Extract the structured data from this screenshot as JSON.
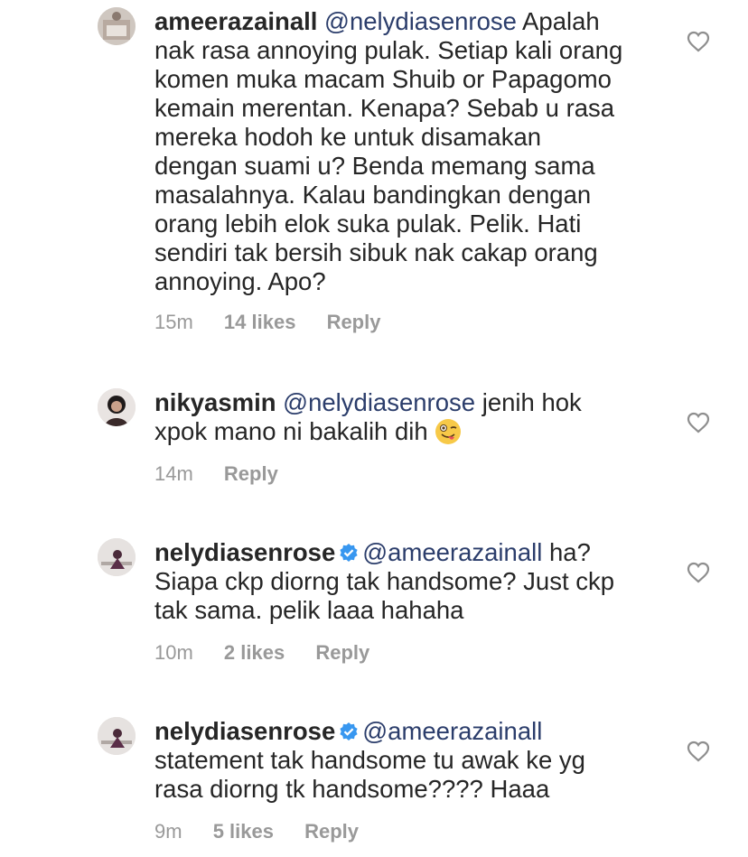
{
  "comments": [
    {
      "username": "ameerazainall",
      "mention": "@nelydiasenrose",
      "text_first": " Apalah",
      "lines": [
        "nak rasa annoying pulak. Setiap kali orang",
        "komen muka macam Shuib or Papagomo",
        "kemain merentan. Kenapa? Sebab u rasa",
        "mereka hodoh ke untuk disamakan",
        "dengan suami u? Benda memang sama",
        "masalahnya. Kalau bandingkan dengan",
        "orang lebih elok suka pulak. Pelik. Hati",
        "sendiri tak bersih sibuk nak cakap orang",
        "annoying. Apo?"
      ],
      "time": "15m",
      "likes": "14 likes",
      "reply": "Reply"
    },
    {
      "username": "nikyasmin",
      "mention": "@nelydiasenrose",
      "text_first": " jenih hok",
      "lines": [
        "xpok mano ni bakalih dih"
      ],
      "emoji": "winking-tongue-face",
      "time": "14m",
      "likes": "",
      "reply": "Reply"
    },
    {
      "username": "nelydiasenrose",
      "verified": true,
      "mention": "@ameerazainall",
      "text_first": " ha?",
      "lines": [
        "Siapa ckp diorng tak handsome? Just ckp",
        "tak sama. pelik laaa hahaha"
      ],
      "time": "10m",
      "likes": "2 likes",
      "reply": "Reply"
    },
    {
      "username": "nelydiasenrose",
      "verified": true,
      "mention": "@ameerazainall",
      "text_first": "",
      "lines": [
        "statement tak handsome tu awak ke yg",
        "rasa diorng tk handsome???? Haaa"
      ],
      "time": "9m",
      "likes": "5 likes",
      "reply": "Reply"
    }
  ],
  "icons": {
    "like": "heart-outline-icon",
    "verified": "verified-badge-icon"
  },
  "colors": {
    "mention": "#2b3d6b",
    "meta": "#999999",
    "verified": "#3897f0"
  }
}
